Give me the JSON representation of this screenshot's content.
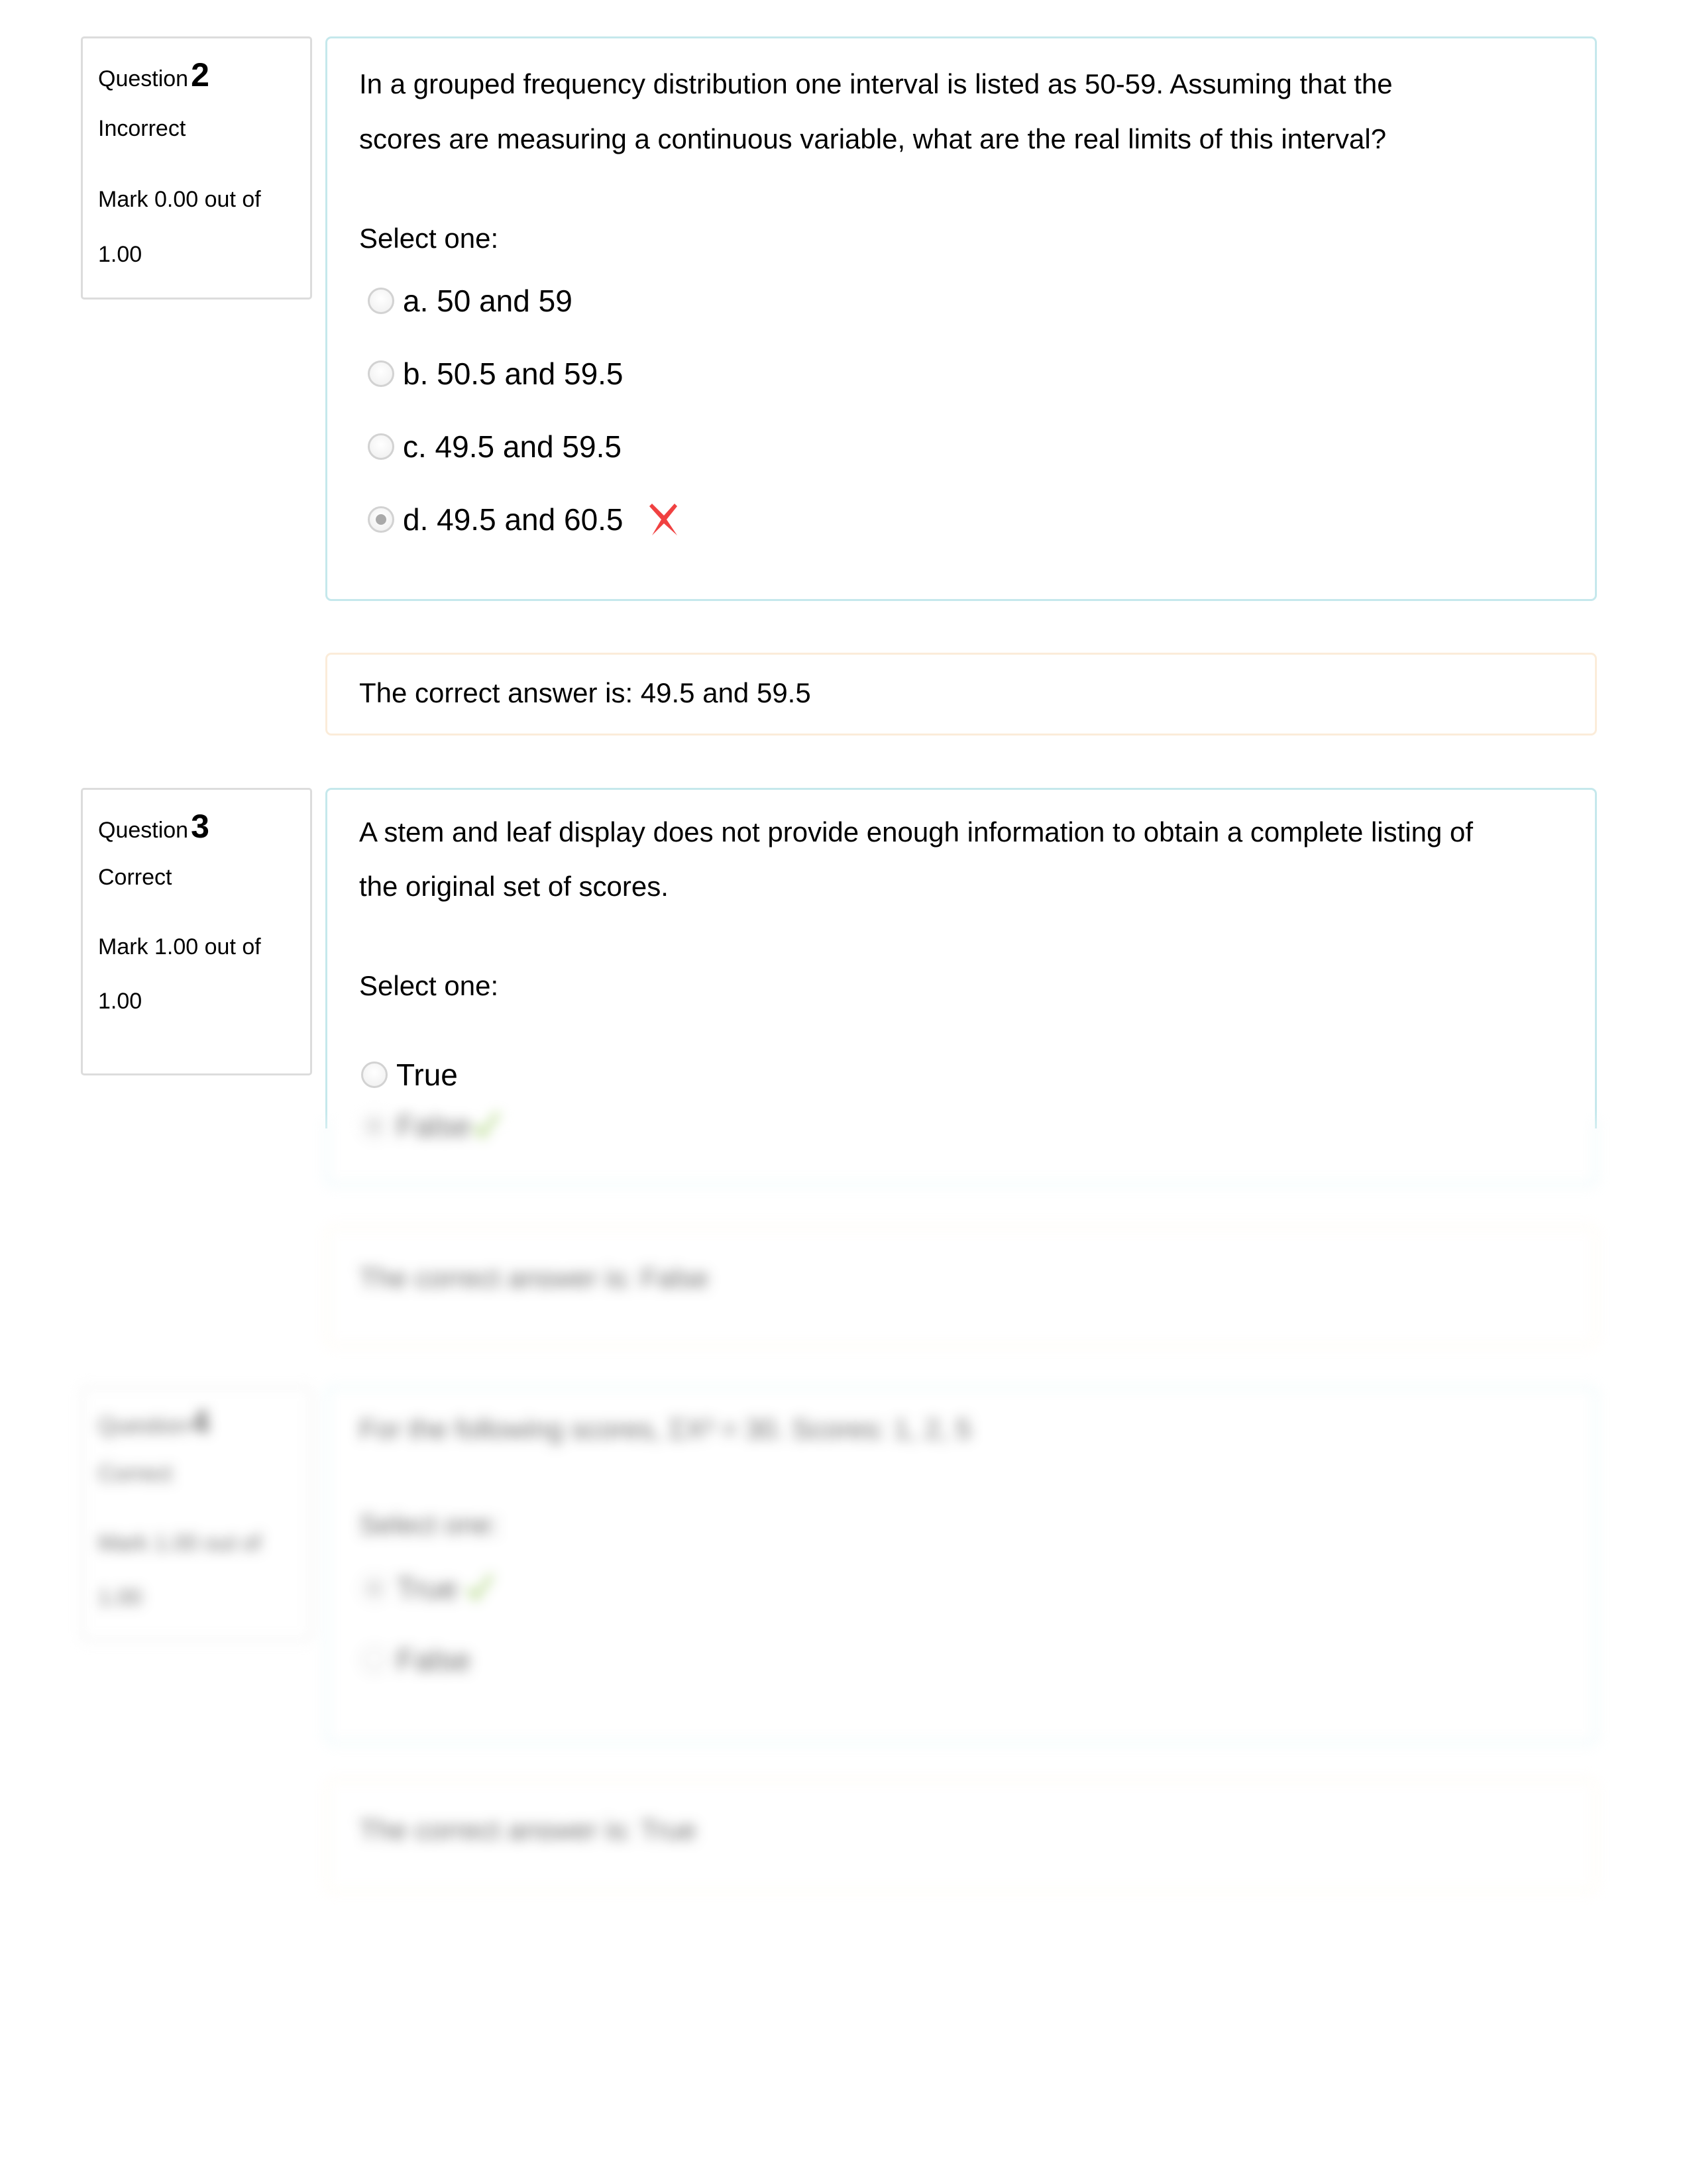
{
  "questions": [
    {
      "number": "2",
      "prefix": "Question",
      "status": "Incorrect",
      "mark_line1": "Mark 0.00 out of",
      "mark_line2": "1.00",
      "text_line1": "In a grouped frequency distribution one interval is listed as 50-59.  Assuming that the",
      "text_line2": "scores are measuring a continuous variable, what are the real limits of this interval?",
      "prompt": "Select one:",
      "options": [
        {
          "label": "a. 50 and 59",
          "selected": false
        },
        {
          "label": "b. 50.5 and 59.5",
          "selected": false
        },
        {
          "label": "c. 49.5 and 59.5",
          "selected": false
        },
        {
          "label": "d. 49.5 and 60.5",
          "selected": true,
          "mark": "incorrect-x-icon"
        }
      ],
      "feedback": "The correct answer is: 49.5 and 59.5"
    },
    {
      "number": "3",
      "prefix": "Question",
      "status": "Correct",
      "mark_line1": "Mark 1.00 out of",
      "mark_line2": "1.00",
      "text_line1": "A stem and leaf display does not provide enough information to obtain a complete listing of",
      "text_line2": "the original set of scores.",
      "prompt": "Select one:",
      "options": [
        {
          "label": "True",
          "selected": false
        },
        {
          "label": "False",
          "selected": true,
          "mark": "correct-check-icon"
        }
      ],
      "feedback": "The correct answer is: False"
    },
    {
      "number": "4",
      "prefix": "Question",
      "status": "Correct",
      "mark_line1": "Mark 1.00 out of",
      "mark_line2": "1.00",
      "text_line1": "For the following scores, ΣX² = 30.  Scores:  1, 2, 5",
      "prompt": "Select one:",
      "options": [
        {
          "label": "True",
          "selected": true,
          "mark": "correct-check-icon"
        },
        {
          "label": "False",
          "selected": false
        }
      ],
      "feedback": "The correct answer is: True"
    }
  ],
  "colors": {
    "incorrect_mark": "#f04141",
    "correct_mark": "#8bc34a",
    "question_border": "#c5e8ec",
    "feedback_border": "#fbecd9",
    "info_border": "#dcdcdc"
  }
}
